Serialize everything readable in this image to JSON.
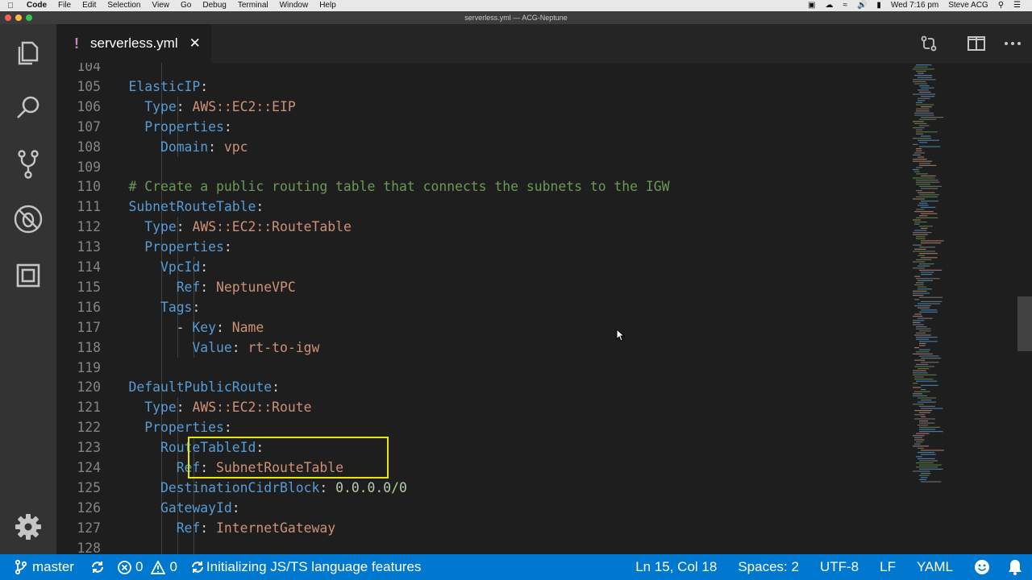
{
  "menubar": {
    "app": "Code",
    "items": [
      "File",
      "Edit",
      "Selection",
      "View",
      "Go",
      "Debug",
      "Terminal",
      "Window",
      "Help"
    ],
    "clock": "Wed 7:16 pm",
    "user": "Steve ACG"
  },
  "window": {
    "title": "serverless.yml — ACG-Neptune"
  },
  "tab": {
    "icon": "!",
    "filename": "serverless.yml",
    "close": "✕"
  },
  "editor": {
    "lines": [
      {
        "n": "104",
        "parts": []
      },
      {
        "n": "105",
        "parts": [
          {
            "t": "    "
          },
          {
            "c": "key",
            "t": "ElasticIP"
          },
          {
            "t": ":"
          }
        ]
      },
      {
        "n": "106",
        "parts": [
          {
            "t": "      "
          },
          {
            "c": "key",
            "t": "Type"
          },
          {
            "t": ": "
          },
          {
            "c": "val",
            "t": "AWS::EC2::EIP"
          }
        ]
      },
      {
        "n": "107",
        "parts": [
          {
            "t": "      "
          },
          {
            "c": "key",
            "t": "Properties"
          },
          {
            "t": ":"
          }
        ]
      },
      {
        "n": "108",
        "parts": [
          {
            "t": "        "
          },
          {
            "c": "key",
            "t": "Domain"
          },
          {
            "t": ": "
          },
          {
            "c": "val",
            "t": "vpc"
          }
        ]
      },
      {
        "n": "109",
        "parts": []
      },
      {
        "n": "110",
        "parts": [
          {
            "t": "    "
          },
          {
            "c": "cmt",
            "t": "# Create a public routing table that connects the subnets to the IGW"
          }
        ]
      },
      {
        "n": "111",
        "parts": [
          {
            "t": "    "
          },
          {
            "c": "key",
            "t": "SubnetRouteTable"
          },
          {
            "t": ":"
          }
        ]
      },
      {
        "n": "112",
        "parts": [
          {
            "t": "      "
          },
          {
            "c": "key",
            "t": "Type"
          },
          {
            "t": ": "
          },
          {
            "c": "val",
            "t": "AWS::EC2::RouteTable"
          }
        ]
      },
      {
        "n": "113",
        "parts": [
          {
            "t": "      "
          },
          {
            "c": "key",
            "t": "Properties"
          },
          {
            "t": ":"
          }
        ]
      },
      {
        "n": "114",
        "parts": [
          {
            "t": "        "
          },
          {
            "c": "key",
            "t": "VpcId"
          },
          {
            "t": ":"
          }
        ]
      },
      {
        "n": "115",
        "parts": [
          {
            "t": "          "
          },
          {
            "c": "key",
            "t": "Ref"
          },
          {
            "t": ": "
          },
          {
            "c": "val",
            "t": "NeptuneVPC"
          }
        ]
      },
      {
        "n": "116",
        "parts": [
          {
            "t": "        "
          },
          {
            "c": "key",
            "t": "Tags"
          },
          {
            "t": ":"
          }
        ]
      },
      {
        "n": "117",
        "parts": [
          {
            "t": "          - "
          },
          {
            "c": "key",
            "t": "Key"
          },
          {
            "t": ": "
          },
          {
            "c": "val",
            "t": "Name"
          }
        ]
      },
      {
        "n": "118",
        "parts": [
          {
            "t": "            "
          },
          {
            "c": "key",
            "t": "Value"
          },
          {
            "t": ": "
          },
          {
            "c": "val",
            "t": "rt-to-igw"
          }
        ]
      },
      {
        "n": "119",
        "parts": []
      },
      {
        "n": "120",
        "parts": [
          {
            "t": "    "
          },
          {
            "c": "key",
            "t": "DefaultPublicRoute"
          },
          {
            "t": ":"
          }
        ]
      },
      {
        "n": "121",
        "parts": [
          {
            "t": "      "
          },
          {
            "c": "key",
            "t": "Type"
          },
          {
            "t": ": "
          },
          {
            "c": "val",
            "t": "AWS::EC2::Route"
          }
        ]
      },
      {
        "n": "122",
        "parts": [
          {
            "t": "      "
          },
          {
            "c": "key",
            "t": "Properties"
          },
          {
            "t": ":"
          }
        ]
      },
      {
        "n": "123",
        "parts": [
          {
            "t": "        "
          },
          {
            "c": "key",
            "t": "RouteTableId"
          },
          {
            "t": ":"
          }
        ]
      },
      {
        "n": "124",
        "parts": [
          {
            "t": "          "
          },
          {
            "c": "key",
            "t": "Ref"
          },
          {
            "t": ": "
          },
          {
            "c": "val",
            "t": "SubnetRouteTable"
          }
        ]
      },
      {
        "n": "125",
        "parts": [
          {
            "t": "        "
          },
          {
            "c": "key",
            "t": "DestinationCidrBlock"
          },
          {
            "t": ": "
          },
          {
            "c": "num",
            "t": "0.0.0.0/0"
          }
        ]
      },
      {
        "n": "126",
        "parts": [
          {
            "t": "        "
          },
          {
            "c": "key",
            "t": "GatewayId"
          },
          {
            "t": ":"
          }
        ]
      },
      {
        "n": "127",
        "parts": [
          {
            "t": "          "
          },
          {
            "c": "key",
            "t": "Ref"
          },
          {
            "t": ": "
          },
          {
            "c": "val",
            "t": "InternetGateway"
          }
        ]
      },
      {
        "n": "128",
        "parts": []
      }
    ]
  },
  "statusbar": {
    "branch": "master",
    "errors": "0",
    "warnings": "0",
    "message": "Initializing JS/TS language features",
    "position": "Ln 15, Col 18",
    "spaces": "Spaces: 2",
    "encoding": "UTF-8",
    "eol": "LF",
    "language": "YAML"
  },
  "colors": {
    "statusbar": "#0078cf",
    "key": "#569cd6",
    "string": "#ce9178",
    "number": "#b5cea8",
    "comment": "#6a9955",
    "highlight": "#e8e800"
  }
}
